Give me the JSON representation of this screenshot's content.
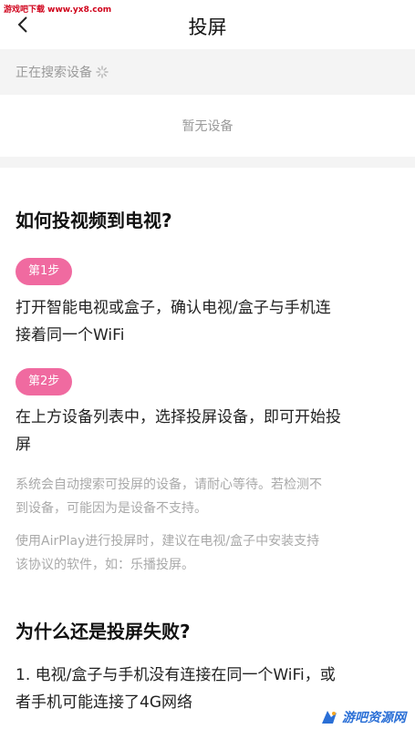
{
  "watermarks": {
    "top_left": "游戏吧下载 www.yx8.com",
    "bottom_right": "游吧资源网"
  },
  "header": {
    "title": "投屏"
  },
  "device_search": {
    "status_text": "正在搜索设备",
    "empty_text": "暂无设备"
  },
  "guide": {
    "heading": "如何投视频到电视?",
    "steps": [
      {
        "badge": "第1步",
        "text_line1": "打开智能电视或盒子，确认电视/盒子与手机连",
        "text_line2": "接着同一个WiFi"
      },
      {
        "badge": "第2步",
        "text_line1": "在上方设备列表中，选择投屏设备，即可开始投",
        "text_line2": "屏"
      }
    ],
    "notes": [
      {
        "line1": "系统会自动搜索可投屏的设备，请耐心等待。若检测不",
        "line2": "到设备，可能因为是设备不支持。"
      },
      {
        "line1": "使用AirPlay进行投屏时，建议在电视/盒子中安装支持",
        "line2": "该协议的软件，如：乐播投屏。"
      }
    ]
  },
  "faq": {
    "heading": "为什么还是投屏失败?",
    "item1_line1": "1. 电视/盒子与手机没有连接在同一个WiFi，或",
    "item1_line2": "者手机可能连接了4G网络"
  },
  "colors": {
    "accent": "#f06aa0",
    "muted_text": "#9a9a9a",
    "band_bg": "#f4f4f4"
  },
  "icons": {
    "back": "chevron-left-icon",
    "spinner": "loading-spinner-icon",
    "watermark": "site-logo-icon"
  }
}
